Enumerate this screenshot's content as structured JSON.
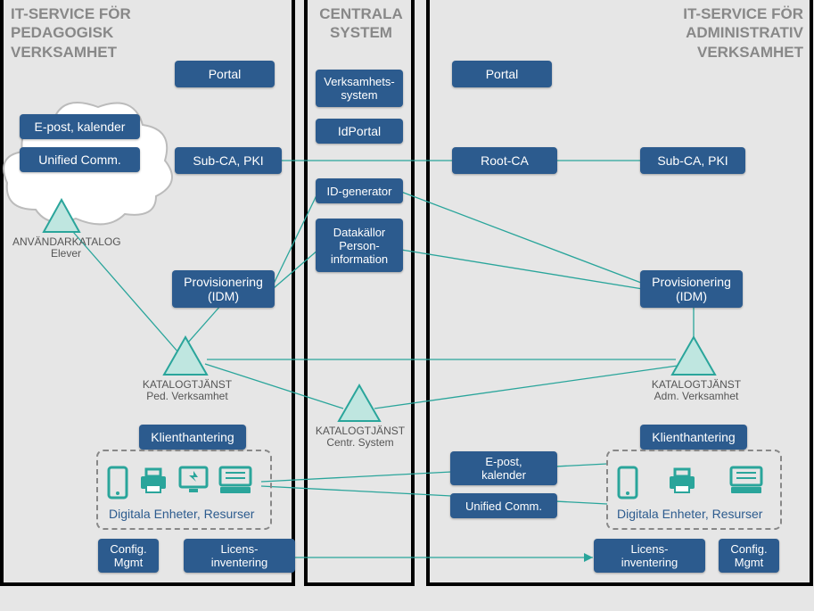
{
  "panels": {
    "left_title": "IT-SERVICE FÖR\nPEDAGOGISK\nVERKSAMHET",
    "center_title": "CENTRALA\nSYSTEM",
    "right_title": "IT-SERVICE FÖR\nADMINISTRATIV\nVERKSAMHET"
  },
  "left": {
    "portal": "Portal",
    "epost": "E-post, kalender",
    "uc": "Unified Comm.",
    "subca": "Sub-CA, PKI",
    "prov": "Provisionering\n(IDM)",
    "klient": "Klienthantering",
    "config": "Config.\nMgmt",
    "licens": "Licens-\ninventering",
    "devlabel": "Digitala Enheter, Resurser",
    "cat_user_title": "ANVÄNDARKATALOG",
    "cat_user_sub": "Elever",
    "cat_ped_title": "KATALOGTJÄNST",
    "cat_ped_sub": "Ped. Verksamhet"
  },
  "center": {
    "verk": "Verksamhets-\nsystem",
    "idportal": "IdPortal",
    "idgen": "ID-generator",
    "datak": "Datakällor\nPerson-\ninformation",
    "cat_c_title": "KATALOGTJÄNST",
    "cat_c_sub": "Centr. System"
  },
  "right": {
    "portal": "Portal",
    "rootca": "Root-CA",
    "subca": "Sub-CA, PKI",
    "prov": "Provisionering\n(IDM)",
    "klient": "Klienthantering",
    "epost": "E-post,\nkalender",
    "uc": "Unified Comm.",
    "licens": "Licens-\ninventering",
    "config": "Config.\nMgmt",
    "devlabel": "Digitala Enheter, Resurser",
    "cat_adm_title": "KATALOGTJÄNST",
    "cat_adm_sub": "Adm. Verksamhet"
  }
}
